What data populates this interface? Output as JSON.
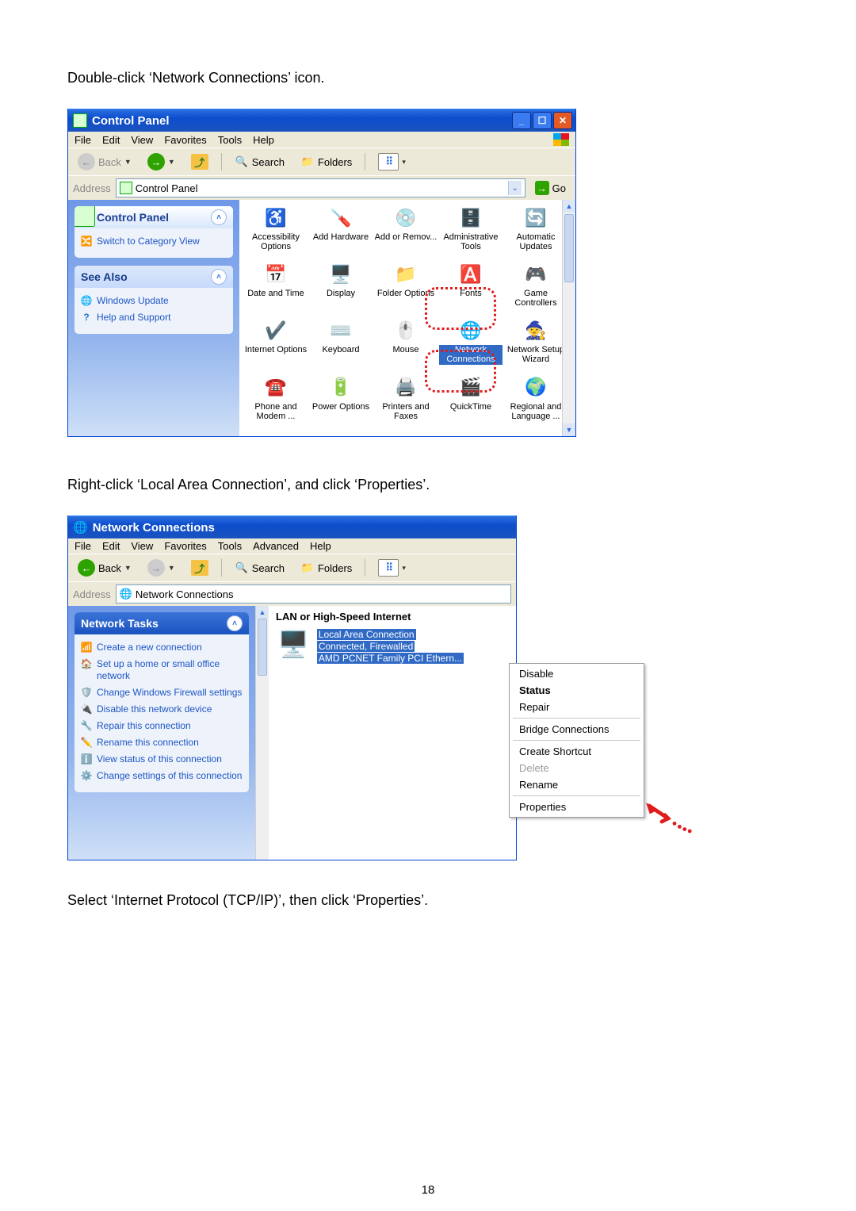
{
  "page_number": "18",
  "instructions": {
    "step1": "Double-click ‘Network Connections’ icon.",
    "step2": "Right-click ‘Local Area Connection’, and click ‘Properties’.",
    "step3": "Select ‘Internet Protocol (TCP/IP)’, then click ‘Properties’."
  },
  "win1": {
    "title": "Control Panel",
    "menus": [
      "File",
      "Edit",
      "View",
      "Favorites",
      "Tools",
      "Help"
    ],
    "toolbar": {
      "back": "Back",
      "search": "Search",
      "folders": "Folders"
    },
    "address": {
      "label": "Address",
      "value": "Control Panel",
      "go": "Go"
    },
    "taskpane": {
      "main_header": "Control Panel",
      "switch_link": "Switch to Category View",
      "see_also_header": "See Also",
      "see_also_links": [
        "Windows Update",
        "Help and Support"
      ]
    },
    "icons": [
      {
        "g": "♿",
        "t": "Accessibility Options"
      },
      {
        "g": "🪛",
        "t": "Add Hardware"
      },
      {
        "g": "💿",
        "t": "Add or Remov..."
      },
      {
        "g": "🗄️",
        "t": "Administrative Tools"
      },
      {
        "g": "🔄",
        "t": "Automatic Updates"
      },
      {
        "g": "📅",
        "t": "Date and Time"
      },
      {
        "g": "🖥️",
        "t": "Display"
      },
      {
        "g": "📁",
        "t": "Folder Options"
      },
      {
        "g": "🅰️",
        "t": "Fonts"
      },
      {
        "g": "🎮",
        "t": "Game Controllers"
      },
      {
        "g": "✔️",
        "t": "Internet Options"
      },
      {
        "g": "⌨️",
        "t": "Keyboard"
      },
      {
        "g": "🖱️",
        "t": "Mouse"
      },
      {
        "g": "🌐",
        "t": "Network Connections"
      },
      {
        "g": "🧙",
        "t": "Network Setup Wizard"
      },
      {
        "g": "☎️",
        "t": "Phone and Modem ..."
      },
      {
        "g": "🔋",
        "t": "Power Options"
      },
      {
        "g": "🖨️",
        "t": "Printers and Faxes"
      },
      {
        "g": "🎬",
        "t": "QuickTime"
      },
      {
        "g": "🌍",
        "t": "Regional and Language ..."
      }
    ]
  },
  "win2": {
    "title": "Network Connections",
    "menus": [
      "File",
      "Edit",
      "View",
      "Favorites",
      "Tools",
      "Advanced",
      "Help"
    ],
    "toolbar": {
      "back": "Back",
      "search": "Search",
      "folders": "Folders"
    },
    "address": {
      "label": "Address",
      "value": "Network Connections"
    },
    "taskpane": {
      "header": "Network Tasks",
      "links": [
        "Create a new connection",
        "Set up a home or small office network",
        "Change Windows Firewall settings",
        "Disable this network device",
        "Repair this connection",
        "Rename this connection",
        "View status of this connection",
        "Change settings of this connection"
      ]
    },
    "group_header": "LAN or High-Speed Internet",
    "connection": {
      "name": "Local Area Connection",
      "status": "Connected, Firewalled",
      "device": "AMD PCNET Family PCI Ethern..."
    },
    "context_menu": [
      "Disable",
      "Status",
      "Repair",
      "Bridge Connections",
      "Create Shortcut",
      "Delete",
      "Rename",
      "Properties"
    ]
  }
}
